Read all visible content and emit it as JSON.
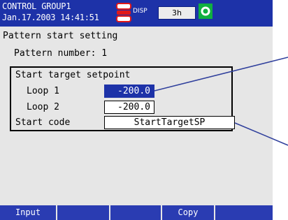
{
  "header": {
    "group_name": "CONTROL GROUP1",
    "datetime": "Jan.17.2003 14:41:51",
    "disp_label": "DISP",
    "trend_rate": "3h"
  },
  "page": {
    "title": "Pattern start setting",
    "pattern_number": "Pattern number: 1"
  },
  "setpoint": {
    "heading": "Start target setpoint",
    "loop1_label": "Loop 1",
    "loop1_value": "-200.0",
    "loop2_label": "Loop 2",
    "loop2_value": "-200.0",
    "start_code_label": "Start code",
    "start_code_value": "StartTargetSP"
  },
  "softkeys": [
    "Input",
    "",
    "",
    "Copy",
    ""
  ],
  "colors": {
    "header_bg": "#1d32a8",
    "screen_bg": "#e6e6e6",
    "selected_bg": "#1d32a8",
    "softkey_bg": "#2a3cb2",
    "alarm_red": "#e01818",
    "status_green": "#10b040"
  }
}
